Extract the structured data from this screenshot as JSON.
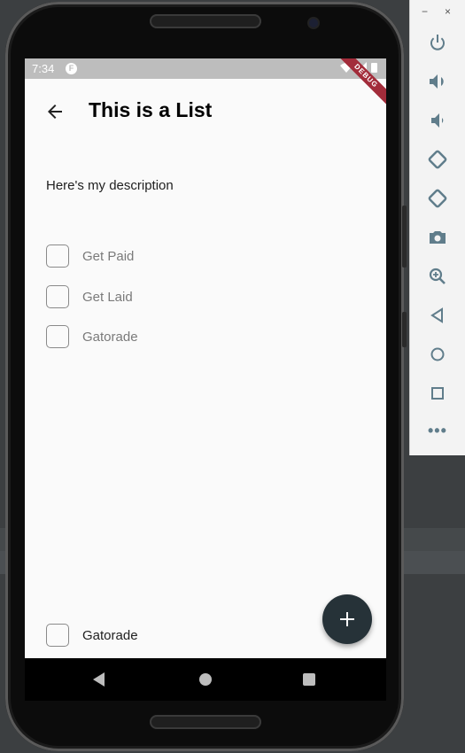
{
  "status_bar": {
    "time": "7:34",
    "app_icon": "flutter-icon",
    "debug_label": "DEBUG"
  },
  "app_bar": {
    "title": "This is a List",
    "back_icon": "arrow-back-icon"
  },
  "description": "Here's my description",
  "todos": [
    {
      "label": "Get Paid",
      "checked": false
    },
    {
      "label": "Get Laid",
      "checked": false
    },
    {
      "label": "Gatorade",
      "checked": false
    }
  ],
  "bottom_todo": {
    "label": "Gatorade",
    "checked": false
  },
  "fab": {
    "icon": "plus-icon",
    "color": "#263238"
  },
  "android_nav": [
    "back-icon",
    "home-icon",
    "recents-icon"
  ],
  "emulator_panel": {
    "window_controls": [
      "−",
      "×"
    ],
    "buttons": [
      "power-icon",
      "volume-up-icon",
      "volume-down-icon",
      "rotate-left-icon",
      "rotate-right-icon",
      "camera-icon",
      "zoom-icon",
      "back-icon",
      "home-icon",
      "overview-icon"
    ],
    "more": "•••",
    "icon_color": "#607d8b"
  }
}
